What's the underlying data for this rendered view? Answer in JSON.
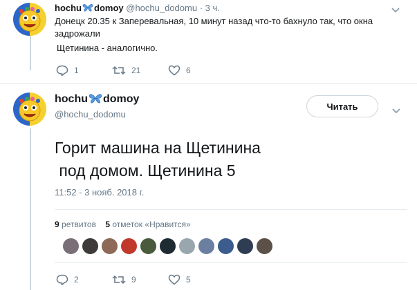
{
  "reply_tweet": {
    "display_name": "hochu",
    "display_name_suffix": "domoy",
    "handle": "@hochu_dodomu",
    "separator": "·",
    "time": "3 ч.",
    "text_line1": "Донецк 20.35 к Заперевальная, 10 минут назад что-то бахнуло так, что окна",
    "text_line2": "задрожали",
    "text_line3": "Щетинина - аналогично.",
    "replies": "1",
    "retweets": "21",
    "likes": "6"
  },
  "main_tweet": {
    "display_name": "hochu",
    "display_name_suffix": "domoy",
    "handle": "@hochu_dodomu",
    "follow_label": "Читать",
    "text": "Горит машина на Щетинина\n под домом. Щетинина 5",
    "timestamp": "11:52 - 3 нояб. 2018 г.",
    "retweet_count": "9",
    "retweet_label": "ретвитов",
    "like_count": "5",
    "like_label": "отметок «Нравится»",
    "replies": "2",
    "retweets": "9",
    "likes": "5",
    "liker_colors": [
      "#7a6f78",
      "#3f3a3a",
      "#8c6a57",
      "#c0392b",
      "#4a5a3d",
      "#1f2b33",
      "#9aa6ad",
      "#6b7fa1",
      "#3b5c8c",
      "#2f3d52",
      "#5c5148"
    ]
  },
  "colors": {
    "accent": "#1da1f2",
    "muted": "#657786",
    "border": "#e6ecf0"
  }
}
